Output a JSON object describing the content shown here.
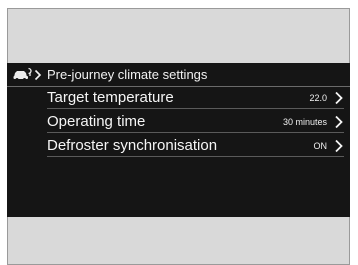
{
  "header": {
    "icon": "car-settings-icon",
    "chevron_icon": "chevron-right-icon",
    "title": "Pre-journey climate settings"
  },
  "rows": [
    {
      "label": "Target temperature",
      "value": "22.0",
      "chevron_icon": "chevron-right-icon"
    },
    {
      "label": "Operating time",
      "value": "30 minutes",
      "chevron_icon": "chevron-right-icon"
    },
    {
      "label": "Defroster synchronisation",
      "value": "ON",
      "chevron_icon": "chevron-right-icon"
    }
  ],
  "colors": {
    "screen_background": "#151515",
    "text": "#f2f2f2",
    "frame_background": "#d9d9d9"
  }
}
